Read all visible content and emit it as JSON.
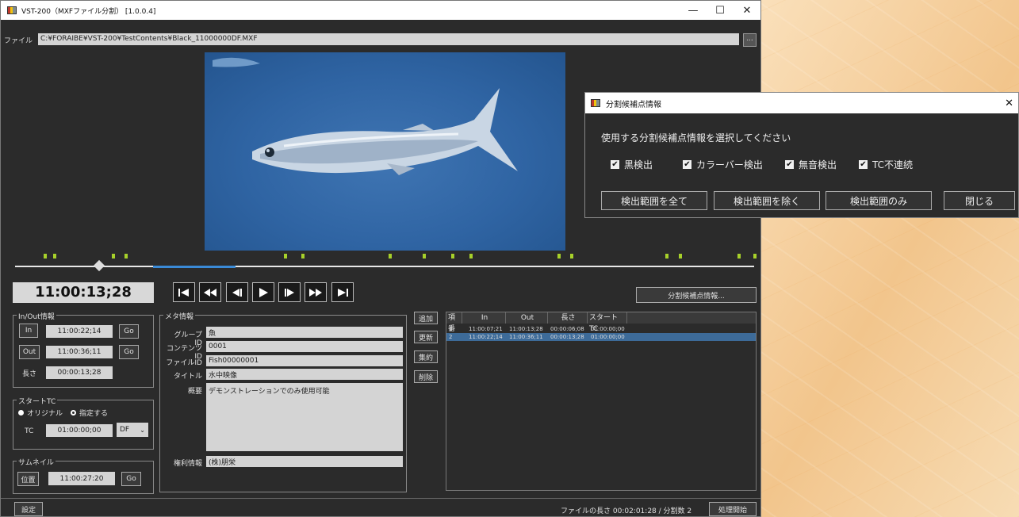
{
  "window": {
    "title": "VST-200（MXFファイル分割） [1.0.0.4]",
    "min": "—",
    "max": "☐",
    "close": "✕"
  },
  "file": {
    "label": "ファイル",
    "path": "C:¥FORAIBE¥VST-200¥TestContents¥Black_11000000DF.MXF",
    "browse": "..."
  },
  "timecode": "11:00:13;28",
  "transport": {
    "icons": [
      "skip-to-start-icon",
      "rewind-icon",
      "step-back-icon",
      "play-icon",
      "step-forward-icon",
      "fast-forward-icon",
      "skip-to-end-icon"
    ],
    "glyphs": [
      "|◀",
      "◀◀",
      "◀|",
      "▶",
      "|▶",
      "▶▶",
      "▶|"
    ]
  },
  "timeline": {
    "playhead_fraction": 0.11
  },
  "split_info_button": "分割候補点情報...",
  "inout": {
    "title": "In/Out情報",
    "in_label": "In",
    "in_value": "11:00:22;14",
    "out_label": "Out",
    "out_value": "11:00:36;11",
    "go_label": "Go",
    "length_label": "長さ",
    "length_value": "00:00:13;28"
  },
  "starttc": {
    "title": "スタートTC",
    "original": "オリジナル",
    "specified": "指定する",
    "tc_label": "TC",
    "tc_value": "01:00:00;00",
    "mode": "DF",
    "selected": "original"
  },
  "thumbnail": {
    "title": "サムネイル",
    "pos_label": "位置",
    "value": "11:00:27:20",
    "go_label": "Go"
  },
  "meta": {
    "title": "メタ情報",
    "group_label": "グループID",
    "group_value": "魚",
    "content_label": "コンテンツID",
    "content_value": "0001",
    "fileid_label": "ファイルID",
    "fileid_value": "Fish00000001",
    "title_label": "タイトル",
    "title_value": "水中映像",
    "summary_label": "概要",
    "summary_value": "デモンストレーションでのみ使用可能",
    "rights_label": "権利情報",
    "rights_value": "(株)朋栄"
  },
  "actions": {
    "add": "追加",
    "update": "更新",
    "merge": "集約",
    "delete": "削除"
  },
  "list": {
    "headers": [
      "項番",
      "In",
      "Out",
      "長さ",
      "スタートTC"
    ],
    "rows": [
      [
        "1",
        "11:00:07;21",
        "11:00:13;28",
        "00:00:06;08",
        "01:00:00;00"
      ],
      [
        "2",
        "11:00:22;14",
        "11:00:36;11",
        "00:00:13;28",
        "01:00:00;00"
      ]
    ]
  },
  "footer": {
    "settings": "設定",
    "status": "ファイルの長さ 00:02:01:28 / 分割数 2",
    "start": "処理開始"
  },
  "dialog": {
    "title": "分割候補点情報",
    "close": "✕",
    "prompt": "使用する分割候補点情報を選択してください",
    "checks": [
      "黒検出",
      "カラーバー検出",
      "無音検出",
      "TC不連続"
    ],
    "buttons": [
      "検出範囲を全て",
      "検出範囲を除く",
      "検出範囲のみ",
      "閉じる"
    ]
  },
  "colors": {
    "window_bg": "#2b2b2b",
    "accent": "#3a8ad6",
    "marker": "#a7d12a",
    "video_bg": "#2f64a3"
  }
}
